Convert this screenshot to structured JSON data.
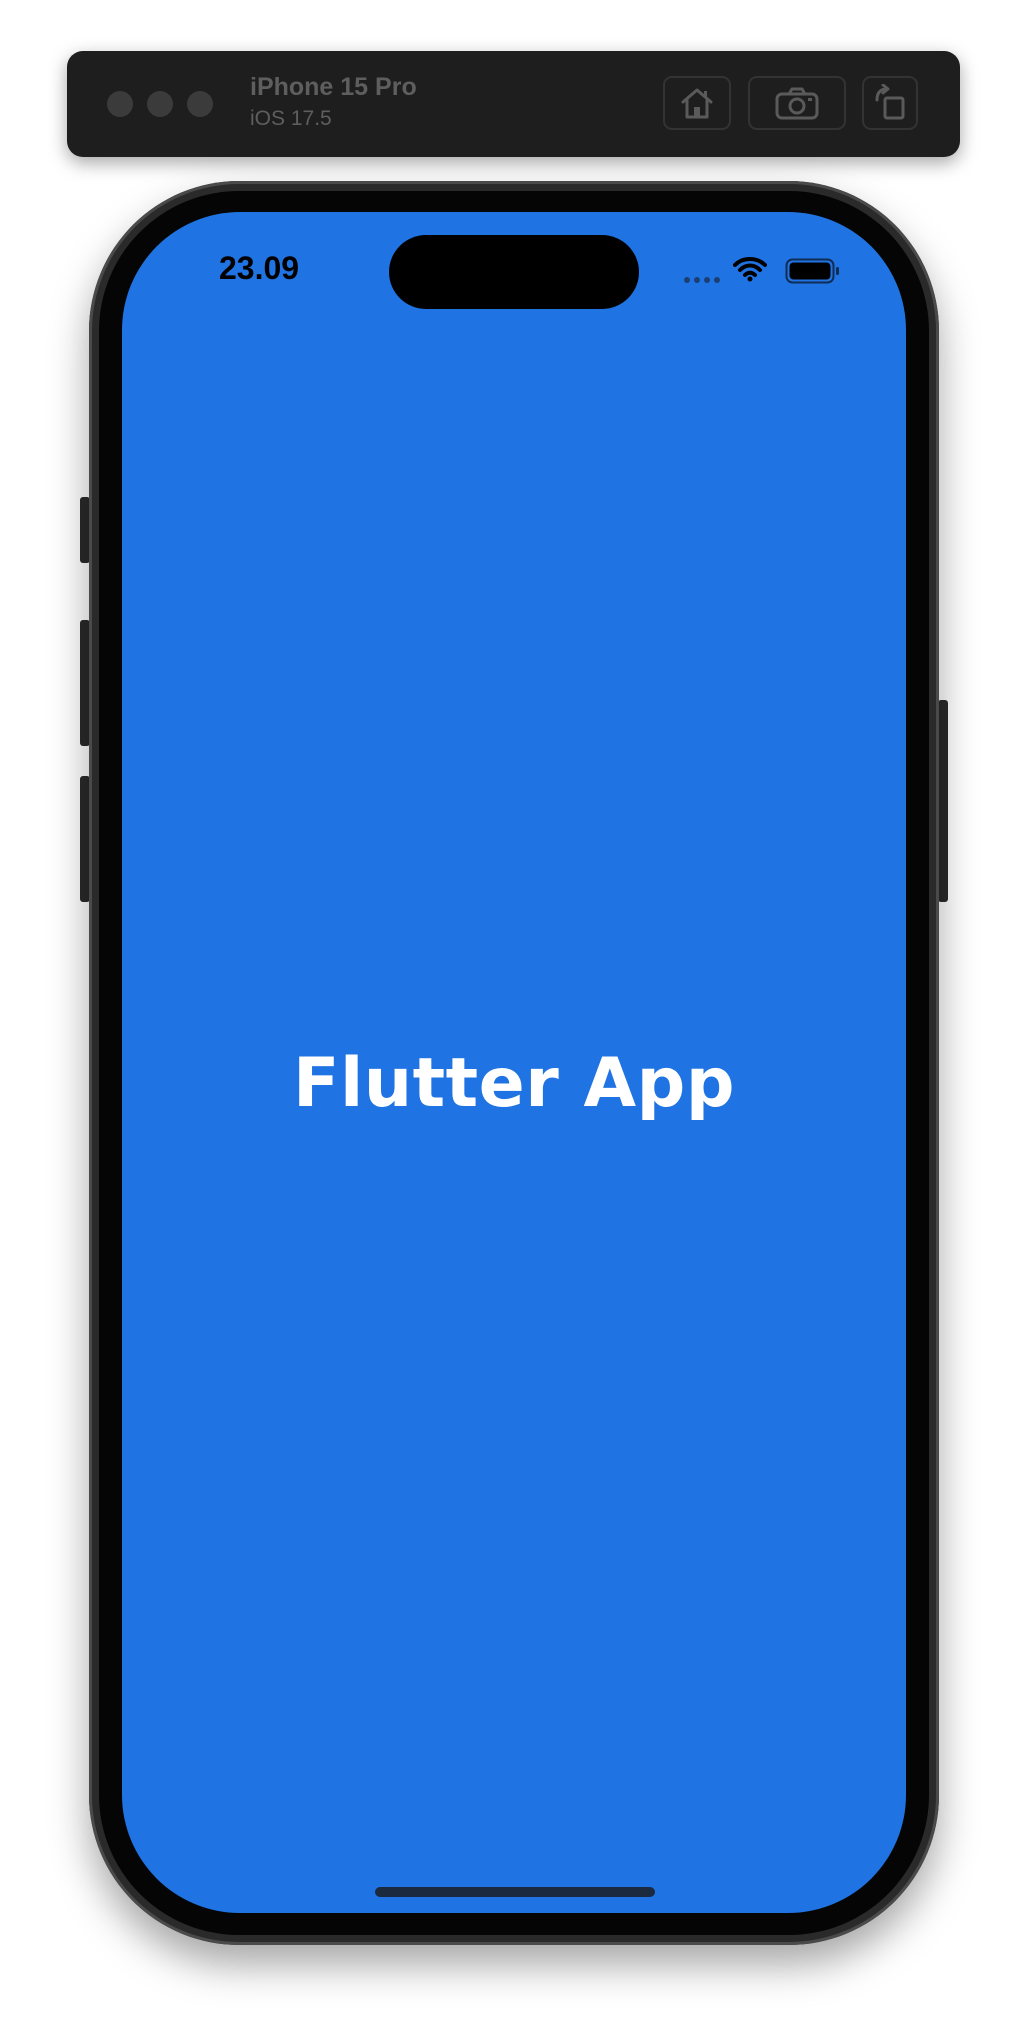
{
  "simulator": {
    "device_name": "iPhone 15 Pro",
    "os_version": "iOS 17.5",
    "buttons": {
      "home_icon": "home-icon",
      "screenshot_icon": "camera-icon",
      "rotate_icon": "rotate-icon"
    }
  },
  "status_bar": {
    "time": "23.09"
  },
  "app": {
    "title": "Flutter App",
    "background_color": "#2073e2",
    "title_color": "#ffffff"
  }
}
